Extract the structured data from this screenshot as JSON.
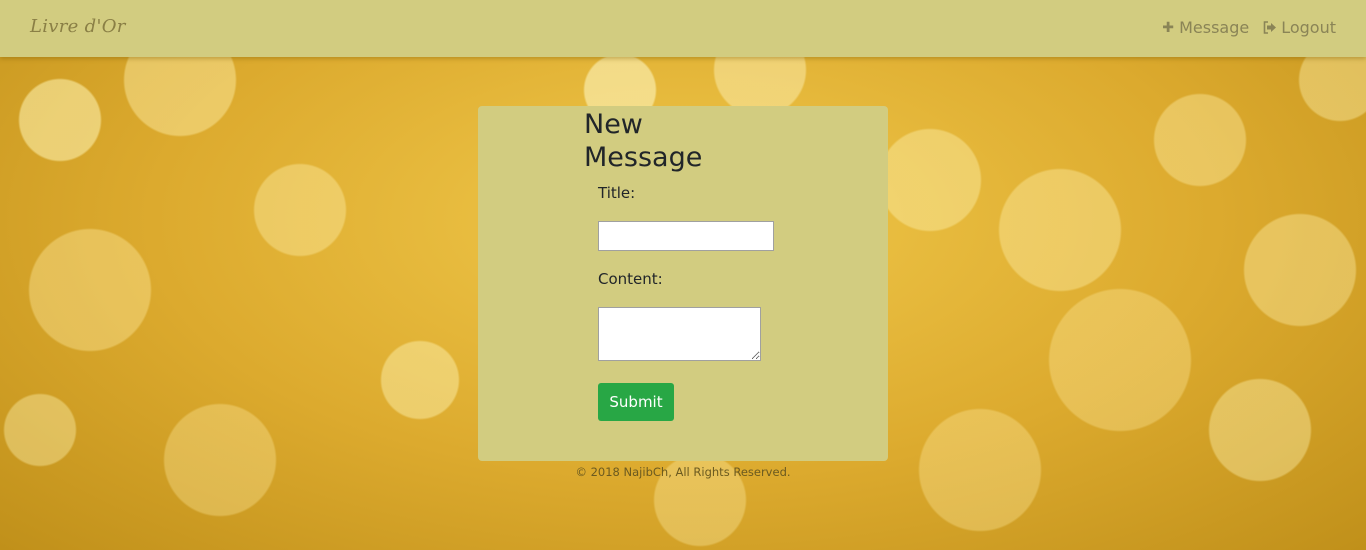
{
  "navbar": {
    "brand": "Livre d'Or",
    "links": [
      {
        "label": "Message",
        "icon": "plus-icon"
      },
      {
        "label": "Logout",
        "icon": "sign-out-icon"
      }
    ]
  },
  "form": {
    "heading": "New Message",
    "title_label": "Title:",
    "title_value": "",
    "content_label": "Content:",
    "content_value": "",
    "submit_label": "Submit"
  },
  "footer": {
    "text": "© 2018 NajibCh, All Rights Reserved."
  },
  "colors": {
    "navbar_bg": "#d2cc80",
    "card_bg": "#d2cc80",
    "submit_bg": "#28a745",
    "nav_text": "#8a8456"
  }
}
